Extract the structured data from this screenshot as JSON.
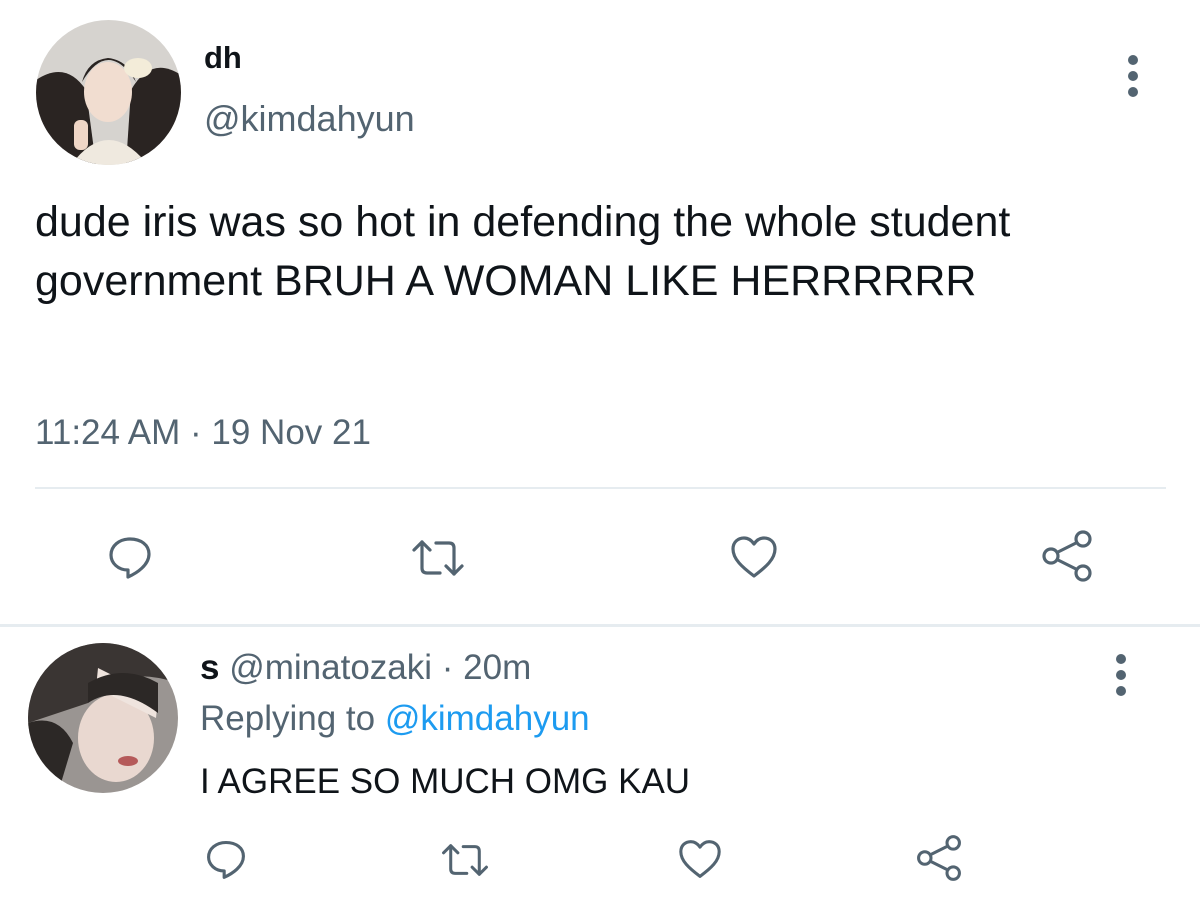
{
  "tweet": {
    "display_name": "dh",
    "handle": "@kimdahyun",
    "text": "dude iris was so hot in defending the whole student government BRUH A WOMAN LIKE HERRRRRR",
    "timestamp": "11:24 AM · 19 Nov 21",
    "actions": [
      "reply-icon",
      "retweet-icon",
      "like-icon",
      "share-icon"
    ]
  },
  "reply": {
    "display_name": "s",
    "handle": "@minatozaki",
    "separator": "·",
    "time": "20m",
    "replying_prefix": "Replying to",
    "replying_to": "@kimdahyun",
    "text": "I AGREE SO MUCH OMG KAU",
    "actions": [
      "reply-icon",
      "retweet-icon",
      "like-icon",
      "share-icon"
    ]
  },
  "colors": {
    "text_primary": "#0f1419",
    "text_secondary": "#536471",
    "link": "#1d9bf0",
    "divider": "#e6ecf0",
    "icon": "#536471"
  }
}
